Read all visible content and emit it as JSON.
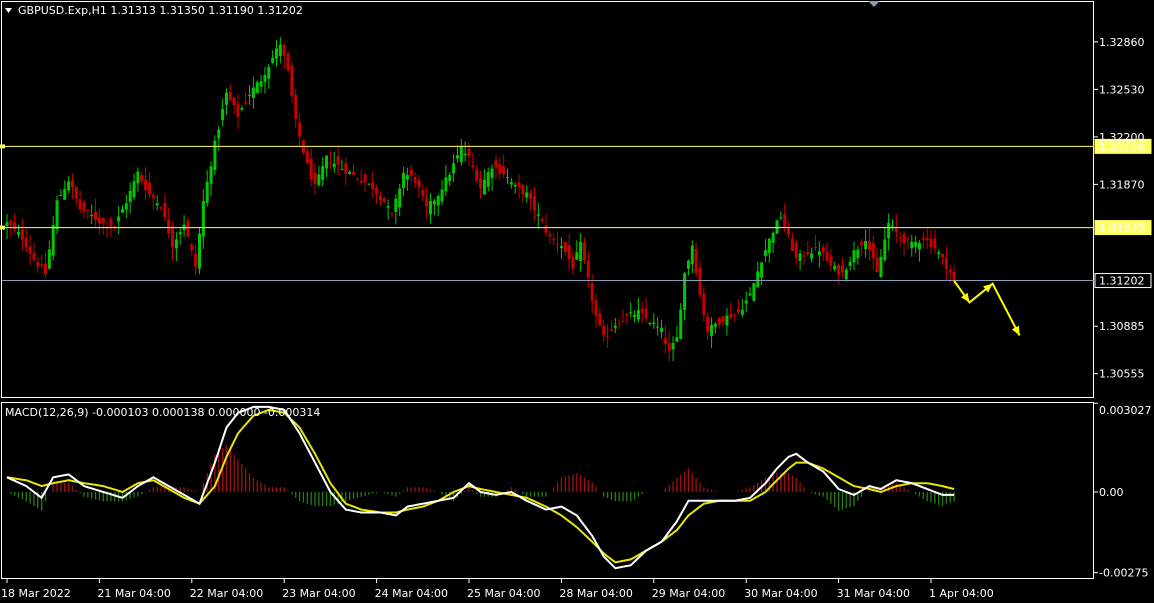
{
  "header": {
    "symbol_line": "GBPUSD.Exp,H1  1.31313 1.31350 1.31190 1.31202"
  },
  "macd_header": "MACD(12,26,9) -0.000103 0.000138 0.000000 -0.000314",
  "colors": {
    "background": "#000000",
    "frame": "#ffffff",
    "bull": "#00c800",
    "bear": "#c80000",
    "level_line": "#ffff66",
    "price_line": "#8a9bb5",
    "macd_main": "#ffffff",
    "macd_signal": "#e6e600",
    "hist_positive": "#a01010",
    "hist_negative": "#2a7a1a",
    "arrow": "#ffff00"
  },
  "chart_data": [
    {
      "type": "candlestick",
      "symbol": "GBPUSD.Exp",
      "timeframe": "H1",
      "ylim": [
        1.304,
        1.3313
      ],
      "y_ticks": [
        "1.32860",
        "1.32530",
        "1.32200",
        "1.31870",
        "1.31570",
        "1.31202",
        "1.30885",
        "1.30555"
      ],
      "x_ticks": [
        "18 Mar 2022",
        "21 Mar 04:00",
        "22 Mar 04:00",
        "23 Mar 04:00",
        "24 Mar 04:00",
        "25 Mar 04:00",
        "28 Mar 04:00",
        "29 Mar 04:00",
        "30 Mar 04:00",
        "31 Mar 04:00",
        "1 Apr 04:00"
      ],
      "close_anchors": [
        [
          0,
          1.316
        ],
        [
          4,
          1.315
        ],
        [
          7,
          1.3135
        ],
        [
          10,
          1.3125
        ],
        [
          13,
          1.3175
        ],
        [
          16,
          1.319
        ],
        [
          19,
          1.317
        ],
        [
          22,
          1.3165
        ],
        [
          25,
          1.316
        ],
        [
          28,
          1.3158
        ],
        [
          31,
          1.3175
        ],
        [
          34,
          1.3195
        ],
        [
          37,
          1.318
        ],
        [
          40,
          1.3172
        ],
        [
          43,
          1.3145
        ],
        [
          46,
          1.316
        ],
        [
          49,
          1.313
        ],
        [
          51,
          1.3175
        ],
        [
          54,
          1.3215
        ],
        [
          57,
          1.325
        ],
        [
          60,
          1.3235
        ],
        [
          63,
          1.325
        ],
        [
          66,
          1.326
        ],
        [
          69,
          1.3275
        ],
        [
          71,
          1.3285
        ],
        [
          73,
          1.3265
        ],
        [
          75,
          1.323
        ],
        [
          78,
          1.32
        ],
        [
          80,
          1.3185
        ],
        [
          83,
          1.3205
        ],
        [
          86,
          1.32
        ],
        [
          89,
          1.3195
        ],
        [
          92,
          1.319
        ],
        [
          95,
          1.3185
        ],
        [
          98,
          1.3175
        ],
        [
          100,
          1.3165
        ],
        [
          103,
          1.3195
        ],
        [
          106,
          1.319
        ],
        [
          109,
          1.317
        ],
        [
          112,
          1.318
        ],
        [
          115,
          1.3195
        ],
        [
          118,
          1.3212
        ],
        [
          120,
          1.3205
        ],
        [
          123,
          1.3185
        ],
        [
          126,
          1.32
        ],
        [
          129,
          1.3195
        ],
        [
          132,
          1.3185
        ],
        [
          135,
          1.318
        ],
        [
          138,
          1.3165
        ],
        [
          141,
          1.315
        ],
        [
          144,
          1.3145
        ],
        [
          147,
          1.313
        ],
        [
          149,
          1.3145
        ],
        [
          151,
          1.312
        ],
        [
          153,
          1.3095
        ],
        [
          155,
          1.308
        ],
        [
          158,
          1.309
        ],
        [
          161,
          1.3095
        ],
        [
          164,
          1.3098
        ],
        [
          167,
          1.3092
        ],
        [
          170,
          1.3085
        ],
        [
          172,
          1.307
        ],
        [
          174,
          1.308
        ],
        [
          176,
          1.3125
        ],
        [
          178,
          1.3145
        ],
        [
          180,
          1.311
        ],
        [
          182,
          1.3085
        ],
        [
          184,
          1.309
        ],
        [
          187,
          1.3095
        ],
        [
          190,
          1.3098
        ],
        [
          193,
          1.311
        ],
        [
          196,
          1.3135
        ],
        [
          199,
          1.3155
        ],
        [
          201,
          1.3165
        ],
        [
          203,
          1.315
        ],
        [
          205,
          1.3135
        ],
        [
          208,
          1.314
        ],
        [
          211,
          1.3142
        ],
        [
          214,
          1.313
        ],
        [
          217,
          1.3125
        ],
        [
          220,
          1.314
        ],
        [
          223,
          1.315
        ],
        [
          226,
          1.3125
        ],
        [
          229,
          1.316
        ],
        [
          232,
          1.315
        ],
        [
          235,
          1.3145
        ],
        [
          238,
          1.315
        ],
        [
          241,
          1.3143
        ],
        [
          243,
          1.3135
        ],
        [
          245,
          1.3126
        ],
        [
          246,
          1.312
        ]
      ],
      "wick_extremes": {
        "high": 1.33,
        "low": 1.3058
      },
      "horizontal_lines": [
        {
          "price": 1.32134,
          "label": "1.32134",
          "style": "level"
        },
        {
          "price": 1.3157,
          "label": "1.31570",
          "style": "level"
        },
        {
          "price": 1.31202,
          "label": "1.31202",
          "style": "current"
        }
      ],
      "annotations": [
        {
          "type": "arrow-path",
          "points": [
            [
              246,
              1.312
            ],
            [
              250,
              1.3105
            ],
            [
              256,
              1.3118
            ],
            [
              263,
              1.3082
            ]
          ]
        }
      ],
      "bar_count": 247
    },
    {
      "type": "line",
      "name": "MACD(12,26,9)",
      "ylim": [
        -0.0029,
        0.003
      ],
      "y_ticks": [
        "0.003027",
        "0.00",
        "-0.00275"
      ],
      "series": [
        {
          "name": "main",
          "anchors": [
            [
              0,
              0.0005
            ],
            [
              5,
              0.0002
            ],
            [
              9,
              -0.0002
            ],
            [
              12,
              0.0005
            ],
            [
              16,
              0.0006
            ],
            [
              20,
              0.0002
            ],
            [
              25,
              0.0
            ],
            [
              30,
              -0.0002
            ],
            [
              34,
              0.0002
            ],
            [
              38,
              0.0005
            ],
            [
              42,
              0.0002
            ],
            [
              46,
              -0.0001
            ],
            [
              50,
              -0.0004
            ],
            [
              54,
              0.001
            ],
            [
              57,
              0.0022
            ],
            [
              60,
              0.0027
            ],
            [
              64,
              0.0029
            ],
            [
              68,
              0.0029
            ],
            [
              72,
              0.0028
            ],
            [
              76,
              0.002
            ],
            [
              80,
              0.001
            ],
            [
              84,
              0.0
            ],
            [
              88,
              -0.0006
            ],
            [
              92,
              -0.0007
            ],
            [
              97,
              -0.0007
            ],
            [
              101,
              -0.0008
            ],
            [
              104,
              -0.0005
            ],
            [
              108,
              -0.0004
            ],
            [
              112,
              -0.0003
            ],
            [
              116,
              -0.0002
            ],
            [
              120,
              0.0003
            ],
            [
              123,
              0.0
            ],
            [
              127,
              -0.0001
            ],
            [
              131,
              0.0
            ],
            [
              135,
              -0.0003
            ],
            [
              140,
              -0.0006
            ],
            [
              144,
              -0.0005
            ],
            [
              148,
              -0.0008
            ],
            [
              152,
              -0.0015
            ],
            [
              155,
              -0.0022
            ],
            [
              158,
              -0.0026
            ],
            [
              162,
              -0.0025
            ],
            [
              166,
              -0.002
            ],
            [
              170,
              -0.0017
            ],
            [
              174,
              -0.001
            ],
            [
              177,
              -0.0003
            ],
            [
              181,
              -0.0003
            ],
            [
              185,
              -0.0003
            ],
            [
              189,
              -0.0003
            ],
            [
              193,
              -0.0002
            ],
            [
              197,
              0.0003
            ],
            [
              200,
              0.0008
            ],
            [
              203,
              0.0012
            ],
            [
              205,
              0.0013
            ],
            [
              208,
              0.001
            ],
            [
              212,
              0.0007
            ],
            [
              216,
              0.0001
            ],
            [
              220,
              -0.0001
            ],
            [
              224,
              0.0002
            ],
            [
              227,
              0.0001
            ],
            [
              231,
              0.0004
            ],
            [
              235,
              0.0003
            ],
            [
              239,
              0.0001
            ],
            [
              243,
              -0.0001
            ],
            [
              246,
              -0.0001
            ]
          ]
        },
        {
          "name": "signal",
          "anchors": [
            [
              0,
              0.0005
            ],
            [
              5,
              0.0004
            ],
            [
              9,
              0.0002
            ],
            [
              12,
              0.0003
            ],
            [
              16,
              0.0004
            ],
            [
              20,
              0.0003
            ],
            [
              25,
              0.0002
            ],
            [
              30,
              0.0
            ],
            [
              34,
              0.0003
            ],
            [
              38,
              0.0004
            ],
            [
              42,
              0.0001
            ],
            [
              46,
              -0.0002
            ],
            [
              50,
              -0.0004
            ],
            [
              54,
              0.0002
            ],
            [
              57,
              0.0012
            ],
            [
              60,
              0.002
            ],
            [
              64,
              0.0026
            ],
            [
              68,
              0.0028
            ],
            [
              72,
              0.0027
            ],
            [
              76,
              0.0022
            ],
            [
              80,
              0.0013
            ],
            [
              84,
              0.0003
            ],
            [
              88,
              -0.0004
            ],
            [
              92,
              -0.0006
            ],
            [
              97,
              -0.0007
            ],
            [
              101,
              -0.0007
            ],
            [
              104,
              -0.0006
            ],
            [
              108,
              -0.0005
            ],
            [
              112,
              -0.0003
            ],
            [
              116,
              0.0
            ],
            [
              120,
              0.0002
            ],
            [
              123,
              0.0001
            ],
            [
              127,
              0.0
            ],
            [
              131,
              -0.0001
            ],
            [
              135,
              -0.0002
            ],
            [
              140,
              -0.0005
            ],
            [
              144,
              -0.0008
            ],
            [
              148,
              -0.0012
            ],
            [
              152,
              -0.0017
            ],
            [
              155,
              -0.0021
            ],
            [
              158,
              -0.0024
            ],
            [
              162,
              -0.0023
            ],
            [
              166,
              -0.002
            ],
            [
              170,
              -0.0017
            ],
            [
              174,
              -0.0013
            ],
            [
              177,
              -0.0008
            ],
            [
              181,
              -0.0004
            ],
            [
              185,
              -0.0003
            ],
            [
              189,
              -0.0003
            ],
            [
              193,
              -0.0003
            ],
            [
              197,
              0.0
            ],
            [
              200,
              0.0004
            ],
            [
              203,
              0.0008
            ],
            [
              205,
              0.001
            ],
            [
              208,
              0.001
            ],
            [
              212,
              0.0008
            ],
            [
              216,
              0.0005
            ],
            [
              220,
              0.0002
            ],
            [
              224,
              0.0001
            ],
            [
              227,
              0.0
            ],
            [
              231,
              0.0002
            ],
            [
              235,
              0.0003
            ],
            [
              239,
              0.0003
            ],
            [
              243,
              0.0002
            ],
            [
              246,
              0.0001
            ]
          ]
        }
      ],
      "histogram": "main minus signal"
    }
  ]
}
